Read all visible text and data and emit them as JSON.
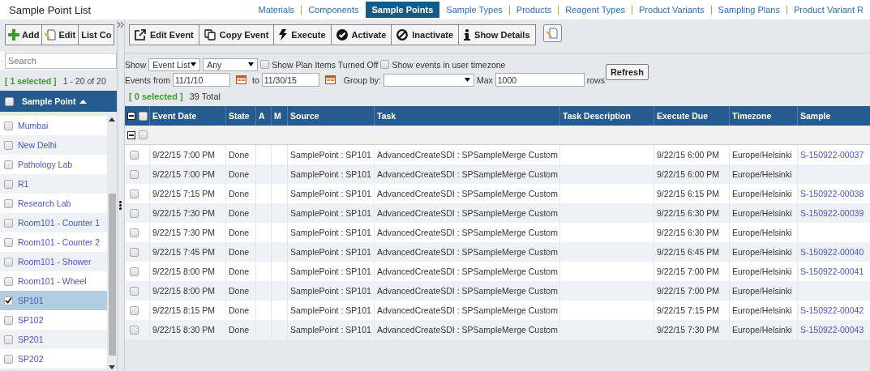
{
  "page_title": "Sample Point List",
  "nav": [
    {
      "label": "Materials",
      "selected": false
    },
    {
      "label": "Components",
      "selected": false
    },
    {
      "label": "Sample Points",
      "selected": true
    },
    {
      "label": "Sample Types",
      "selected": false
    },
    {
      "label": "Products",
      "selected": false
    },
    {
      "label": "Reagent Types",
      "selected": false
    },
    {
      "label": "Product Variants",
      "selected": false
    },
    {
      "label": "Sampling Plans",
      "selected": false
    },
    {
      "label": "Product Variant R",
      "selected": false
    }
  ],
  "left_toolbar": [
    {
      "label": "Add",
      "kind": "plus"
    },
    {
      "label": "Edit",
      "kind": "edit"
    },
    {
      "label": "List Co",
      "kind": "text"
    }
  ],
  "search": {
    "placeholder": "Search"
  },
  "left_selection": "[ 1 selected ]",
  "left_range": "1 - 20 of 20",
  "left_column": "Sample Point",
  "left_all_checked": false,
  "sample_points": [
    {
      "name": "Mumbai",
      "checked": false,
      "selected": false
    },
    {
      "name": "New Delhi",
      "checked": false,
      "selected": false
    },
    {
      "name": "Pathology Lab",
      "checked": false,
      "selected": false
    },
    {
      "name": "R1",
      "checked": false,
      "selected": false
    },
    {
      "name": "Research Lab",
      "checked": false,
      "selected": false
    },
    {
      "name": "Room101 - Counter 1",
      "checked": false,
      "selected": false
    },
    {
      "name": "Room101 - Counter 2",
      "checked": false,
      "selected": false
    },
    {
      "name": "Room101 - Shower",
      "checked": false,
      "selected": false
    },
    {
      "name": "Room101 - Wheel",
      "checked": false,
      "selected": false
    },
    {
      "name": "SP101",
      "checked": true,
      "selected": true
    },
    {
      "name": "SP102",
      "checked": false,
      "selected": false
    },
    {
      "name": "SP201",
      "checked": false,
      "selected": false
    },
    {
      "name": "SP202",
      "checked": false,
      "selected": false
    }
  ],
  "right_toolbar": [
    {
      "label": "Edit Event",
      "kind": "external"
    },
    {
      "label": "Copy Event",
      "kind": "copy"
    },
    {
      "label": "Execute",
      "kind": "bolt"
    },
    {
      "label": "Activate",
      "kind": "check"
    },
    {
      "label": "Inactivate",
      "kind": "ban"
    },
    {
      "label": "Show Details",
      "kind": "info"
    }
  ],
  "filters": {
    "show_label": "Show",
    "show_type": "Event List",
    "show_state": "Any",
    "plan_items": {
      "label": "Show Plan Items Turned Off",
      "checked": false
    },
    "user_tz": {
      "label": "Show events in user timezone",
      "checked": false
    },
    "from_label": "Events from",
    "from": "11/1/10",
    "to_label": "to",
    "to": "11/30/15",
    "group_label": "Group by:",
    "max_label": "Max",
    "max": "1000",
    "rows_label": "rows",
    "refresh": "Refresh"
  },
  "events_selection": "[ 0 selected ]",
  "events_total": "39 Total",
  "events_all_checked": false,
  "group_checked": false,
  "columns": [
    "Event Date",
    "State",
    "A",
    "M",
    "Source",
    "Task",
    "Task Description",
    "Execute Due",
    "Timezone",
    "Sample"
  ],
  "events": [
    {
      "date": "9/22/15 7:00 PM",
      "state": "Done",
      "source": "SamplePoint : SP101",
      "task": "AdvancedCreateSDI : SPSampleMerge Custom",
      "due": "9/22/15 6:00 PM",
      "timezone": "Europe/Helsinki",
      "sample": "S-150922-00037",
      "checked": false
    },
    {
      "date": "9/22/15 7:00 PM",
      "state": "Done",
      "source": "SamplePoint : SP101",
      "task": "AdvancedCreateSDI : SPSampleMerge Custom",
      "due": "9/22/15 6:00 PM",
      "timezone": "Europe/Helsinki",
      "checked": false
    },
    {
      "date": "9/22/15 7:15 PM",
      "state": "Done",
      "source": "SamplePoint : SP101",
      "task": "AdvancedCreateSDI : SPSampleMerge Custom",
      "due": "9/22/15 6:15 PM",
      "timezone": "Europe/Helsinki",
      "sample": "S-150922-00038",
      "checked": false
    },
    {
      "date": "9/22/15 7:30 PM",
      "state": "Done",
      "source": "SamplePoint : SP101",
      "task": "AdvancedCreateSDI : SPSampleMerge Custom",
      "due": "9/22/15 6:30 PM",
      "timezone": "Europe/Helsinki",
      "sample": "S-150922-00039",
      "checked": false
    },
    {
      "date": "9/22/15 7:30 PM",
      "state": "Done",
      "source": "SamplePoint : SP101",
      "task": "AdvancedCreateSDI : SPSampleMerge Custom",
      "due": "9/22/15 6:30 PM",
      "timezone": "Europe/Helsinki",
      "checked": false
    },
    {
      "date": "9/22/15 7:45 PM",
      "state": "Done",
      "source": "SamplePoint : SP101",
      "task": "AdvancedCreateSDI : SPSampleMerge Custom",
      "due": "9/22/15 6:45 PM",
      "timezone": "Europe/Helsinki",
      "sample": "S-150922-00040",
      "checked": false
    },
    {
      "date": "9/22/15 8:00 PM",
      "state": "Done",
      "source": "SamplePoint : SP101",
      "task": "AdvancedCreateSDI : SPSampleMerge Custom",
      "due": "9/22/15 7:00 PM",
      "timezone": "Europe/Helsinki",
      "sample": "S-150922-00041",
      "checked": false
    },
    {
      "date": "9/22/15 8:00 PM",
      "state": "Done",
      "source": "SamplePoint : SP101",
      "task": "AdvancedCreateSDI : SPSampleMerge Custom",
      "due": "9/22/15 7:00 PM",
      "timezone": "Europe/Helsinki",
      "checked": false
    },
    {
      "date": "9/22/15 8:15 PM",
      "state": "Done",
      "source": "SamplePoint : SP101",
      "task": "AdvancedCreateSDI : SPSampleMerge Custom",
      "due": "9/22/15 7:15 PM",
      "timezone": "Europe/Helsinki",
      "sample": "S-150922-00042",
      "checked": false
    },
    {
      "date": "9/22/15 8:30 PM",
      "state": "Done",
      "source": "SamplePoint : SP101",
      "task": "AdvancedCreateSDI : SPSampleMerge Custom",
      "due": "9/22/15 7:30 PM",
      "timezone": "Europe/Helsinki",
      "sample": "S-150922-00043",
      "checked": false
    }
  ]
}
